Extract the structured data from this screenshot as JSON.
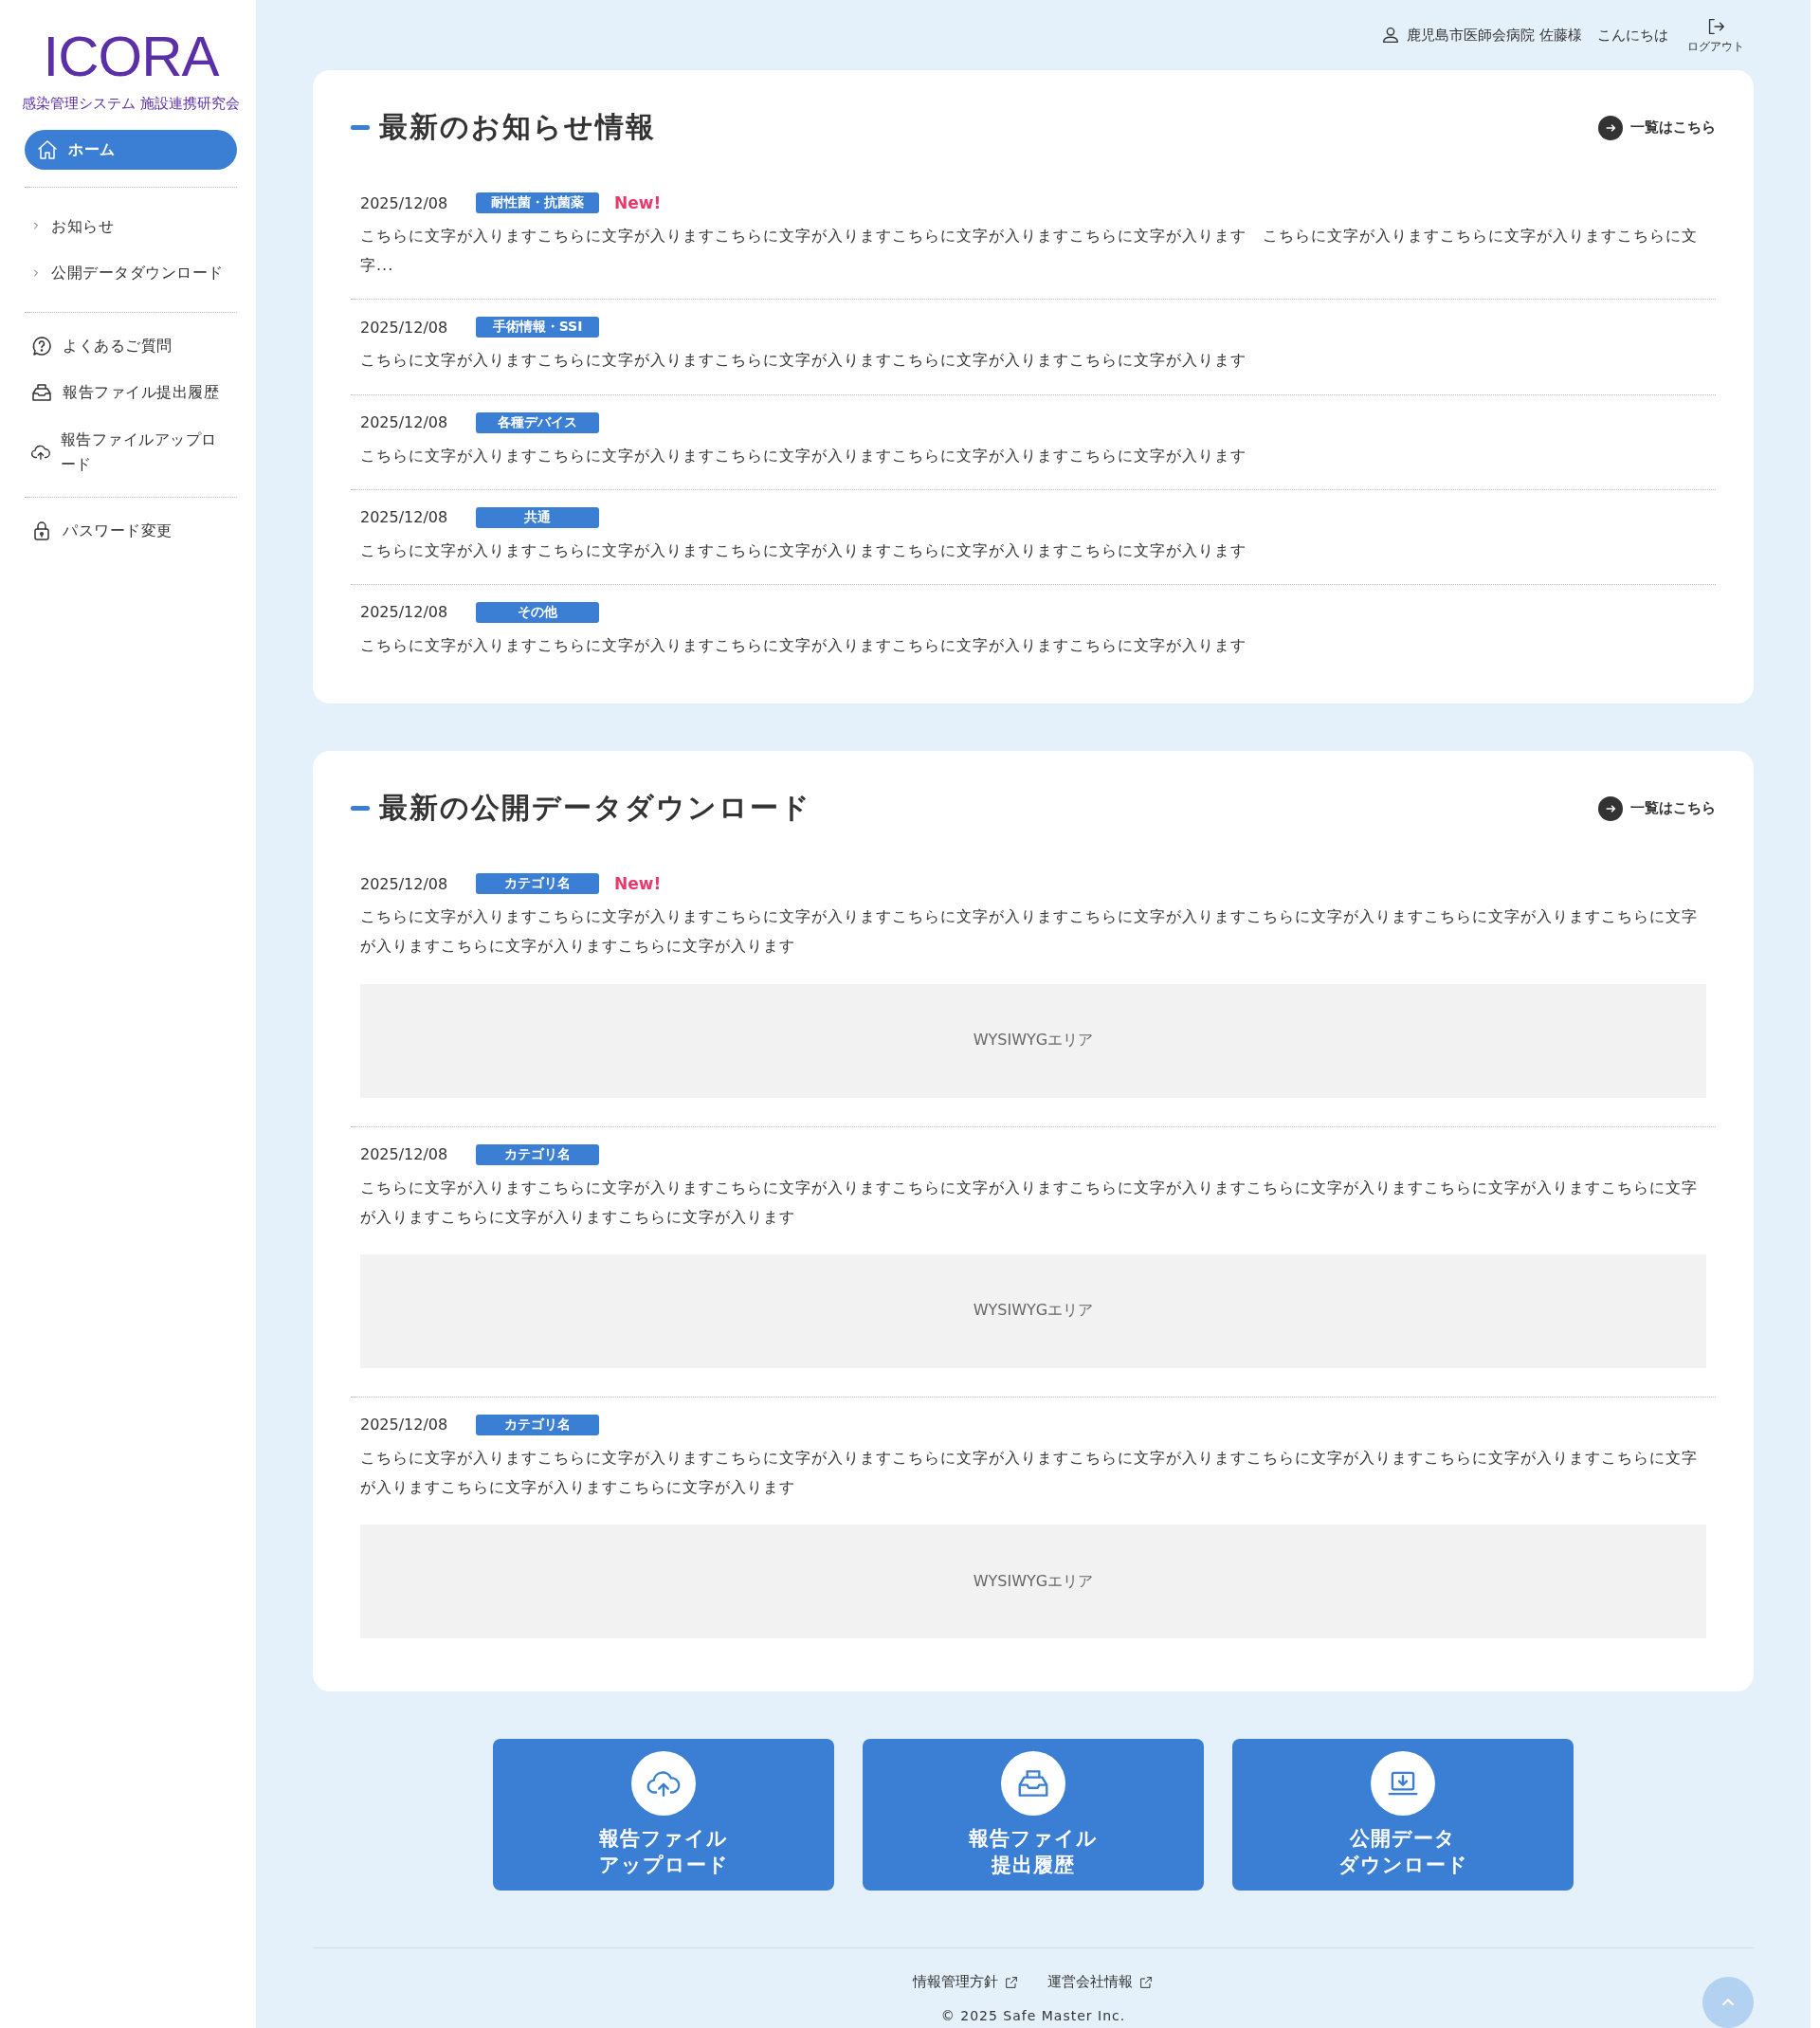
{
  "sidebar": {
    "logo": "ICORA",
    "subtitle": "感染管理システム 施設連携研究会",
    "groups": [
      [
        {
          "label": "ホーム",
          "kind": "pill",
          "selected": true
        }
      ],
      [
        {
          "label": "お知らせ",
          "kind": "sub",
          "selected": false
        },
        {
          "label": "公開データダウンロード",
          "kind": "sub",
          "selected": false
        }
      ],
      [
        {
          "label": "よくあるご質問",
          "kind": "icon",
          "selected": false
        },
        {
          "label": "報告ファイル提出履歴",
          "kind": "icon",
          "selected": false
        },
        {
          "label": "報告ファイルアップロード",
          "kind": "icon",
          "selected": false
        }
      ],
      [
        {
          "label": "パスワード変更",
          "kind": "icon",
          "selected": false
        }
      ]
    ]
  },
  "header": {
    "user": "鹿児島市医師会病院 佐藤様",
    "greeting": "こんにちは",
    "logout": "ログアウト"
  },
  "news": {
    "title": "最新のお知らせ情報",
    "more": "一覧はこちら",
    "items": [
      {
        "date": "2025/12/08",
        "category": "耐性菌・抗菌薬",
        "new_label": "New!",
        "text": "こちらに文字が入りますこちらに文字が入りますこちらに文字が入りますこちらに文字が入りますこちらに文字が入ります　こちらに文字が入りますこちらに文字が入りますこちらに文字..."
      },
      {
        "date": "2025/12/08",
        "category": "手術情報・SSI",
        "text": "こちらに文字が入りますこちらに文字が入りますこちらに文字が入りますこちらに文字が入りますこちらに文字が入ります"
      },
      {
        "date": "2025/12/08",
        "category": "各種デバイス",
        "text": "こちらに文字が入りますこちらに文字が入りますこちらに文字が入りますこちらに文字が入りますこちらに文字が入ります"
      },
      {
        "date": "2025/12/08",
        "category": "共通",
        "text": "こちらに文字が入りますこちらに文字が入りますこちらに文字が入りますこちらに文字が入りますこちらに文字が入ります"
      },
      {
        "date": "2025/12/08",
        "category": "その他",
        "text": "こちらに文字が入りますこちらに文字が入りますこちらに文字が入りますこちらに文字が入りますこちらに文字が入ります"
      }
    ]
  },
  "downloads": {
    "title": "最新の公開データダウンロード",
    "more": "一覧はこちら",
    "items": [
      {
        "date": "2025/12/08",
        "category": "カテゴリ名",
        "new_label": "New!",
        "text": "こちらに文字が入りますこちらに文字が入りますこちらに文字が入りますこちらに文字が入りますこちらに文字が入りますこちらに文字が入りますこちらに文字が入りますこちらに文字が入りますこちらに文字が入りますこちらに文字が入ります",
        "wysiwyg": "WYSIWYGエリア"
      },
      {
        "date": "2025/12/08",
        "category": "カテゴリ名",
        "text": "こちらに文字が入りますこちらに文字が入りますこちらに文字が入りますこちらに文字が入りますこちらに文字が入りますこちらに文字が入りますこちらに文字が入りますこちらに文字が入りますこちらに文字が入りますこちらに文字が入ります",
        "wysiwyg": "WYSIWYGエリア"
      },
      {
        "date": "2025/12/08",
        "category": "カテゴリ名",
        "text": "こちらに文字が入りますこちらに文字が入りますこちらに文字が入りますこちらに文字が入りますこちらに文字が入りますこちらに文字が入りますこちらに文字が入りますこちらに文字が入りますこちらに文字が入りますこちらに文字が入ります",
        "wysiwyg": "WYSIWYGエリア"
      }
    ]
  },
  "quick_links": [
    {
      "lines": [
        "報告ファイル",
        "アップロード"
      ]
    },
    {
      "lines": [
        "報告ファイル",
        "提出履歴"
      ]
    },
    {
      "lines": [
        "公開データ",
        "ダウンロード"
      ]
    }
  ],
  "footer": {
    "links": [
      "情報管理方針",
      "運営会社情報"
    ],
    "copyright": "© 2025 Safe Master Inc."
  }
}
